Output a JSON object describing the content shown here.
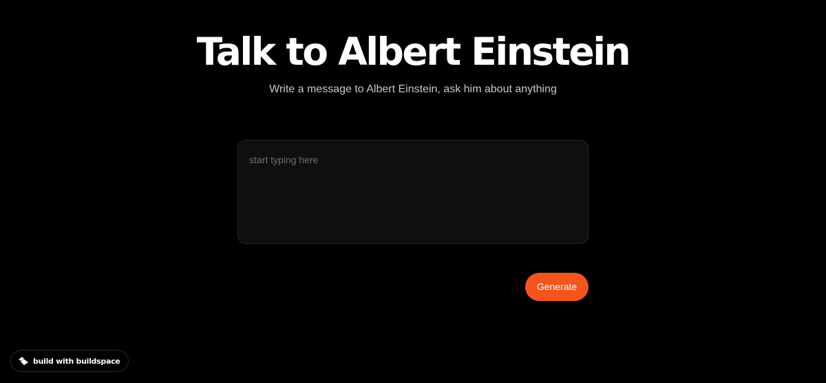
{
  "header": {
    "title": "Talk to Albert Einstein",
    "subtitle": "Write a message to Albert Einstein, ask him about anything"
  },
  "prompt": {
    "placeholder": "start typing here",
    "value": ""
  },
  "actions": {
    "generate_label": "Generate"
  },
  "badge": {
    "label": "build with buildspace",
    "icon": "buildspace-logo-icon"
  },
  "colors": {
    "background": "#000000",
    "accent": "#f5541d",
    "input_background": "#0f0f0f",
    "subtitle_text": "#c8c8c8"
  }
}
